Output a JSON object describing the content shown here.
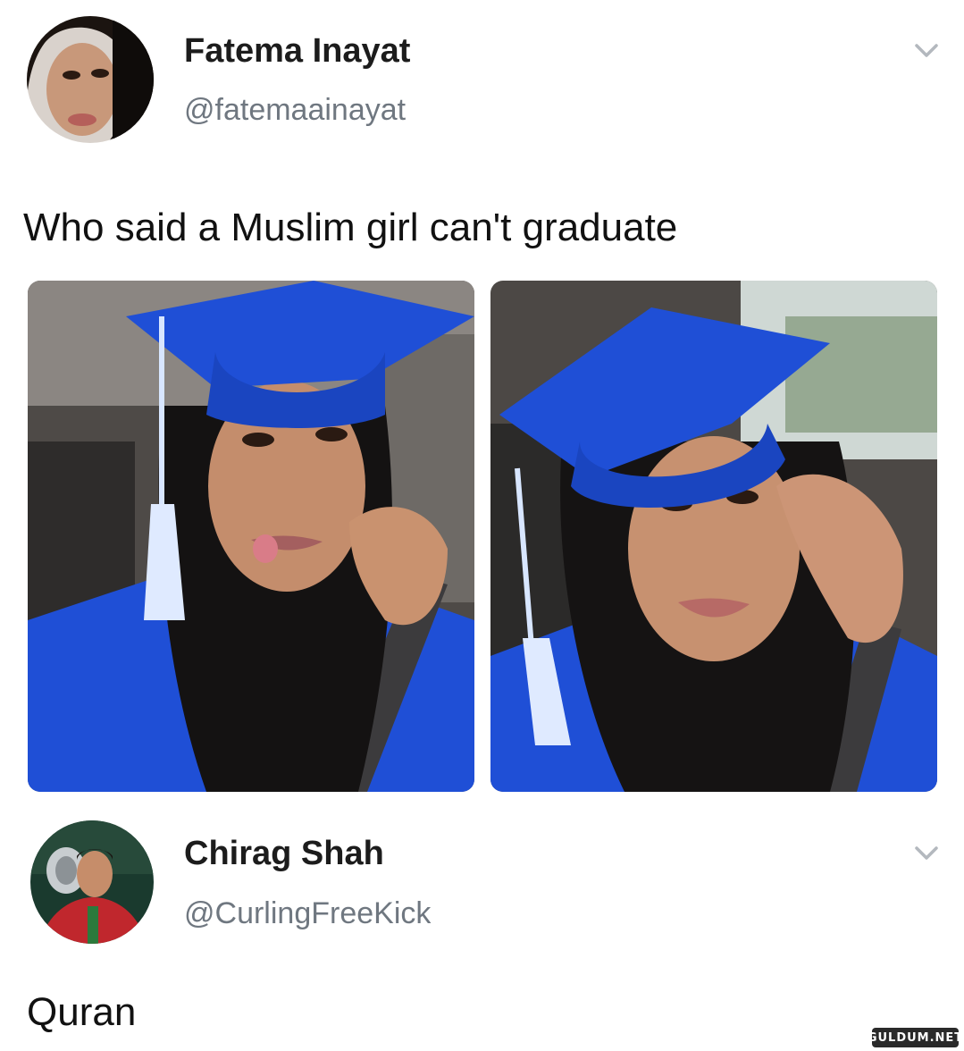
{
  "tweet": {
    "author": {
      "display_name": "Fatema Inayat",
      "handle": "@fatemaainayat",
      "avatar": "profile-photo"
    },
    "text": "Who said a Muslim girl can't graduate",
    "menu_icon": "chevron-down-icon",
    "media": [
      {
        "description_icon": "graduation-photo-1"
      },
      {
        "description_icon": "graduation-photo-2"
      }
    ]
  },
  "reply": {
    "author": {
      "display_name": "Chirag Shah",
      "handle": "@CurlingFreeKick",
      "avatar": "profile-photo"
    },
    "text": "Quran",
    "menu_icon": "chevron-down-icon"
  },
  "watermark": "GULDUM.NET",
  "colors": {
    "handle": "#6f7780",
    "chevron": "#b3b8be",
    "cap_blue": "#1f4fd6"
  }
}
